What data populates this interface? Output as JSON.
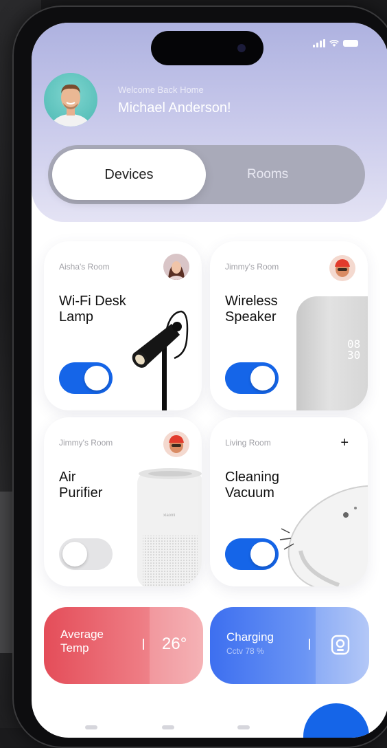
{
  "status_bar": {
    "signal_icon": "signal-icon",
    "wifi_icon": "wifi-icon",
    "battery_icon": "battery-icon"
  },
  "header": {
    "greeting": "Welcome Back Home",
    "user_name": "Michael Anderson!"
  },
  "tabs": {
    "active": "Devices",
    "inactive": "Rooms"
  },
  "devices": [
    {
      "room": "Aisha's Room",
      "name": "Wi-Fi Desk\nLamp",
      "on": true,
      "badge": "avatar"
    },
    {
      "room": "Jimmy's Room",
      "name": "Wireless\nSpeaker",
      "on": true,
      "badge": "avatar",
      "speaker_time": "08\n30"
    },
    {
      "room": "Jimmy's Room",
      "name": "Air\nPurifier",
      "on": false,
      "badge": "avatar",
      "brand": "xiaomi"
    },
    {
      "room": "Living Room",
      "name": "Cleaning\nVacuum",
      "on": true,
      "badge": "plus",
      "plus_label": "+"
    }
  ],
  "stats": {
    "temp": {
      "label": "Average\nTemp",
      "value": "26°",
      "color": "#e44d59"
    },
    "charging": {
      "label": "Charging",
      "sub": "Cctv 78 %",
      "icon": "camera-icon",
      "color": "#3d6ff0"
    }
  },
  "accent_color": "#1565e8"
}
